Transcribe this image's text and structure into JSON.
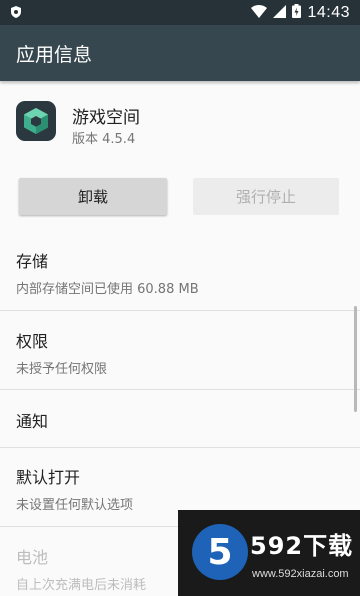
{
  "status_bar": {
    "time": "14:43",
    "icons": [
      "shield-icon",
      "wifi-icon",
      "signal-icon",
      "battery-icon"
    ]
  },
  "app_bar": {
    "title": "应用信息"
  },
  "app": {
    "name": "游戏空间",
    "version": "版本 4.5.4",
    "icon": "game-space-app-icon"
  },
  "buttons": {
    "uninstall": "卸载",
    "force_stop": "强行停止"
  },
  "sections": {
    "storage": {
      "title": "存储",
      "subtitle": "内部存储空间已使用 60.88 MB"
    },
    "permissions": {
      "title": "权限",
      "subtitle": "未授予任何权限"
    },
    "notifications": {
      "title": "通知"
    },
    "open_by_default": {
      "title": "默认打开",
      "subtitle": "未设置任何默认选项"
    },
    "battery": {
      "title": "电池",
      "subtitle": "自上次充满电后未消耗"
    }
  },
  "watermark": {
    "logo_digit": "5",
    "title": "592下载",
    "url": "www.592xiazai.com"
  },
  "colors": {
    "status_bar": "#263238",
    "app_bar": "#37474f",
    "background": "#fafafa",
    "watermark_blue": "#1e63b7"
  }
}
